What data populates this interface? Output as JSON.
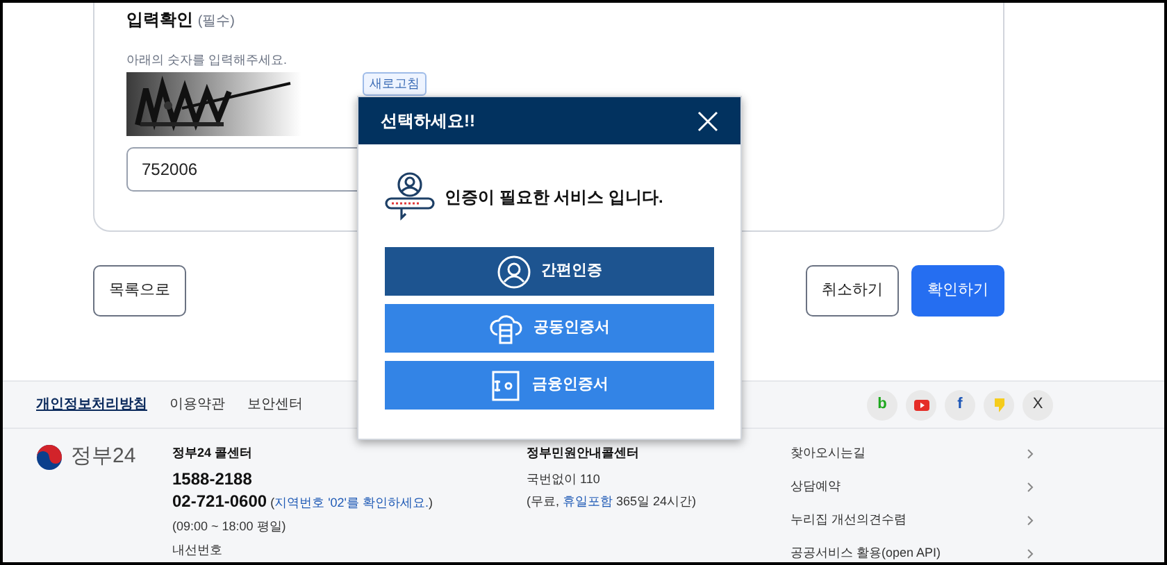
{
  "form": {
    "heading": "입력확인",
    "required": "(필수)",
    "hint": "아래의 숫자를 입력해주세요.",
    "refresh": "새로고침",
    "input_value": "752006"
  },
  "actions": {
    "list": "목록으로",
    "cancel": "취소하기",
    "confirm": "확인하기"
  },
  "modal": {
    "title": "선택하세요!!",
    "message": "인증이 필요한 서비스 입니다.",
    "options": [
      {
        "label": "간편인증",
        "kind": "simple",
        "selected": true
      },
      {
        "label": "공동인증서",
        "kind": "joint",
        "selected": false
      },
      {
        "label": "금융인증서",
        "kind": "finance",
        "selected": false
      }
    ]
  },
  "footer": {
    "links": [
      {
        "label": "개인정보처리방침",
        "emphasized": true
      },
      {
        "label": "이용약관",
        "emphasized": false
      },
      {
        "label": "보안센터",
        "emphasized": false
      }
    ],
    "social": [
      {
        "kind": "blog",
        "glyph": "b"
      },
      {
        "kind": "youtube"
      },
      {
        "kind": "facebook",
        "glyph": "f"
      },
      {
        "kind": "kakao"
      },
      {
        "kind": "x",
        "glyph": "X"
      }
    ],
    "logo_text": "정부24",
    "callcenter": {
      "title": "정부24 콜센터",
      "phone": "1588-2188",
      "lines": [
        [
          {
            "text": "02-721-0600",
            "kind": "strong"
          },
          {
            "text": " (",
            "kind": "plain"
          },
          {
            "text": "지역번호 '02'를 확인하세요.",
            "kind": "link"
          },
          {
            "text": ")",
            "kind": "plain"
          }
        ],
        [
          {
            "text": "(09:00 ~ 18:00 평일)",
            "kind": "plain"
          }
        ],
        [
          {
            "text": "내선번호",
            "kind": "plain"
          }
        ]
      ]
    },
    "civil": {
      "title": "정부민원안내콜센터",
      "lines": [
        [
          {
            "text": "국번없이 110",
            "kind": "plain"
          }
        ],
        [
          {
            "text": "(무료, ",
            "kind": "plain"
          },
          {
            "text": "휴일포함",
            "kind": "link"
          },
          {
            "text": " 365일 24시간)",
            "kind": "plain"
          }
        ]
      ]
    },
    "menu": [
      "찾아오시는길",
      "상담예약",
      "누리집 개선의견수렴",
      "공공서비스 활용(open API)"
    ]
  }
}
